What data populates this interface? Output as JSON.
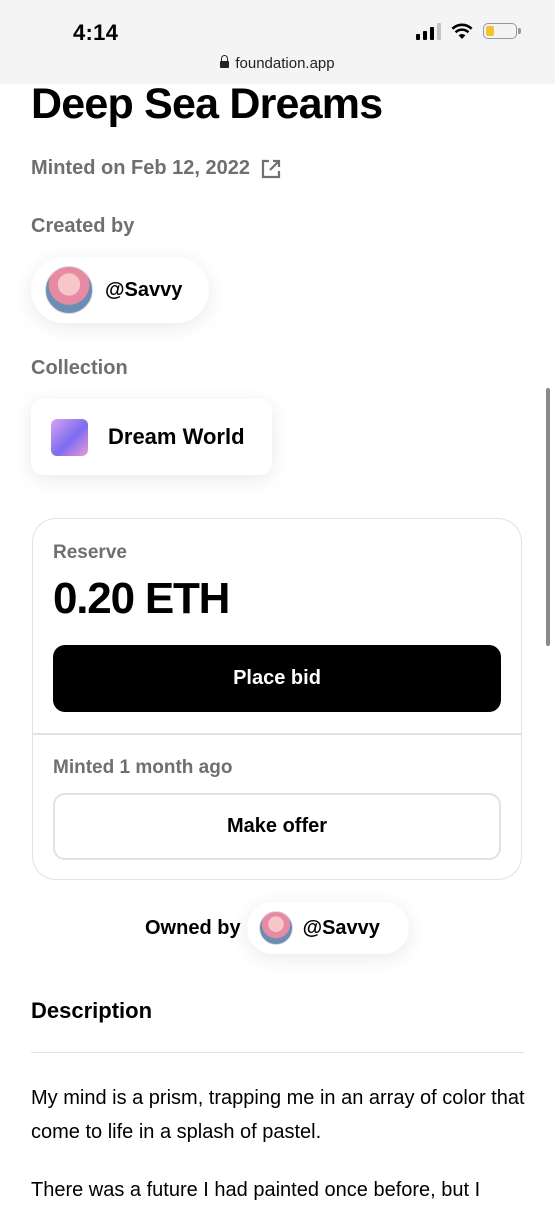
{
  "status_bar": {
    "time": "4:14",
    "url": "foundation.app"
  },
  "artwork": {
    "title": "Deep Sea Dreams",
    "minted_on": "Minted on Feb 12, 2022"
  },
  "creator": {
    "label": "Created by",
    "handle": "@Savvy"
  },
  "collection": {
    "label": "Collection",
    "name": "Dream World"
  },
  "auction": {
    "reserve_label": "Reserve",
    "reserve_value": "0.20 ETH",
    "place_bid_label": "Place bid",
    "minted_ago": "Minted 1 month ago",
    "make_offer_label": "Make offer"
  },
  "owner": {
    "label": "Owned by",
    "handle": "@Savvy"
  },
  "description": {
    "heading": "Description",
    "paragraph1": "My mind is a prism, trapping me in an array of color that come to life in a splash of pastel.",
    "paragraph2": "There was a future I had painted once before, but I"
  },
  "colors": {
    "battery": "#f1c232",
    "primary_button": "#000000",
    "muted_text": "#6f6f6f"
  }
}
